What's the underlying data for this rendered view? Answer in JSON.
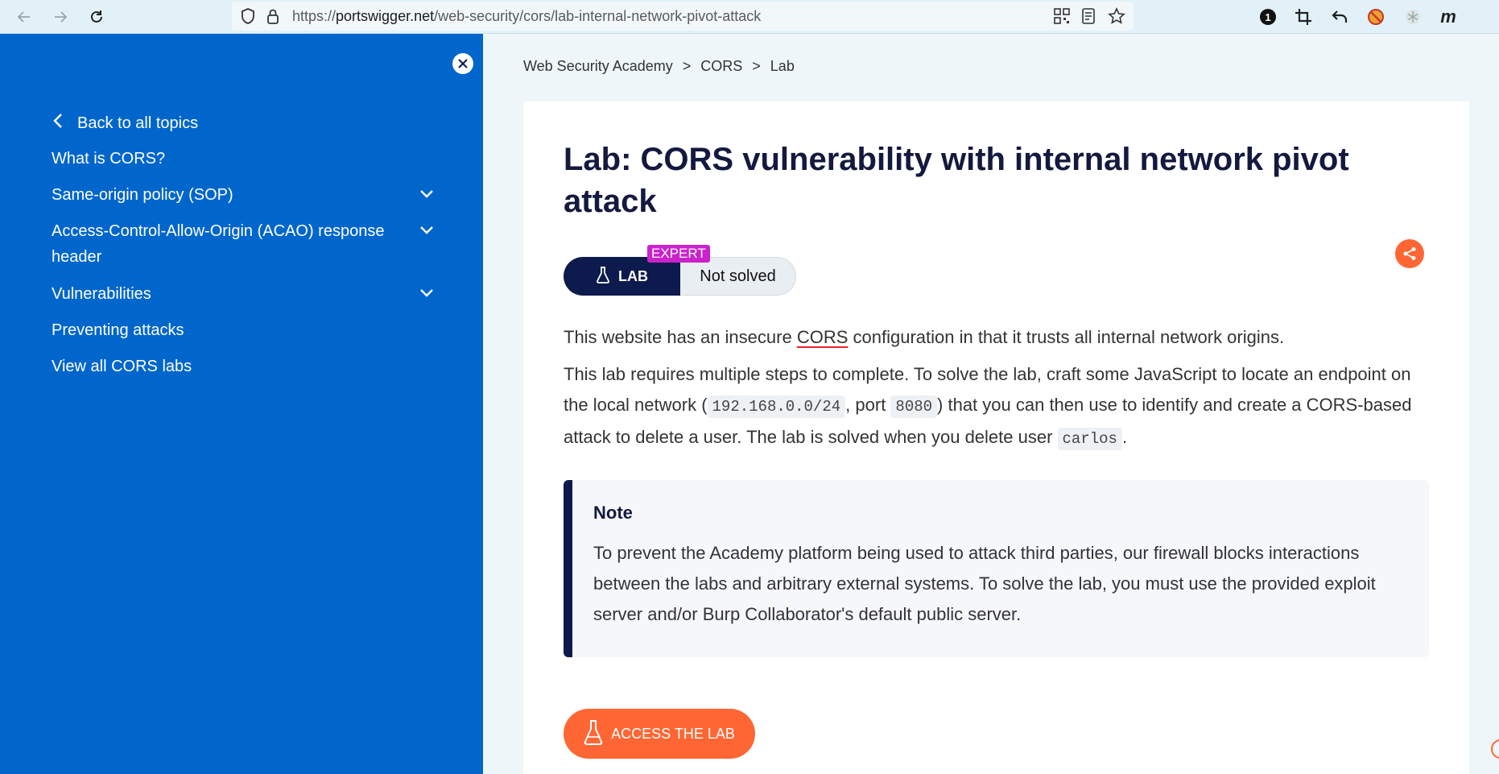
{
  "browser": {
    "url_prefix": "https://",
    "url_host": "portswigger.net",
    "url_path": "/web-security/cors/lab-internal-network-pivot-attack",
    "ext_badge": "1",
    "ext_m": "m"
  },
  "sidebar": {
    "back_label": "Back to all topics",
    "items": [
      {
        "label": "What is CORS?"
      },
      {
        "label": "Same-origin policy (SOP)"
      },
      {
        "label": "Access-Control-Allow-Origin (ACAO) response header"
      },
      {
        "label": "Vulnerabilities"
      },
      {
        "label": "Preventing attacks"
      },
      {
        "label": "View all CORS labs"
      }
    ]
  },
  "breadcrumb": {
    "items": [
      "Web Security Academy",
      "CORS",
      "Lab"
    ],
    "separator": ">"
  },
  "lab": {
    "title": "Lab: CORS vulnerability with internal network pivot attack",
    "pill_label": "LAB",
    "level": "EXPERT",
    "status": "Not solved",
    "p1_before": "This website has an insecure ",
    "p1_link": "CORS",
    "p1_after": " configuration in that it trusts all internal network origins.",
    "p2_a": "This lab requires multiple steps to complete. To solve the lab, craft some JavaScript to locate an endpoint on the local network (",
    "p2_code1": "192.168.0.0/24",
    "p2_b": ", port ",
    "p2_code2": "8080",
    "p2_c": ") that you can then use to identify and create a CORS-based attack to delete a user. The lab is solved when you delete user ",
    "p2_code3": "carlos",
    "p2_d": "."
  },
  "note": {
    "title": "Note",
    "text": "To prevent the Academy platform being used to attack third parties, our firewall blocks interactions between the labs and arbitrary external systems. To solve the lab, you must use the provided exploit server and/or Burp Collaborator's default public server."
  },
  "access_button": {
    "label": "ACCESS THE LAB"
  },
  "colors": {
    "sidebar_bg": "#0066cc",
    "accent": "#ff6633",
    "navy": "#0d1a4d",
    "expert": "#cc22cc"
  }
}
